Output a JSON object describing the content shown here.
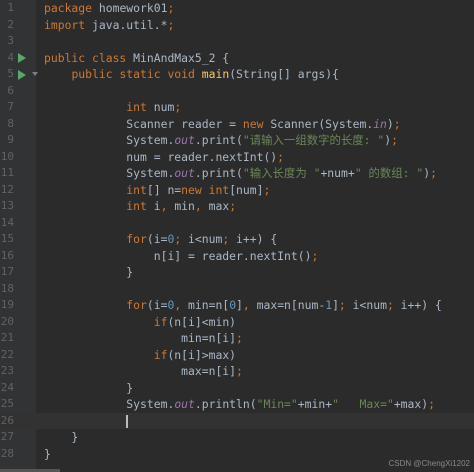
{
  "editor": {
    "lines": [
      {
        "n": "1",
        "tokens": [
          {
            "c": "kw",
            "t": "package "
          },
          {
            "c": "txt",
            "t": "homework01"
          },
          {
            "c": "kw",
            "t": ";"
          }
        ]
      },
      {
        "n": "2",
        "tokens": [
          {
            "c": "kw",
            "t": "import "
          },
          {
            "c": "txt",
            "t": "java.util.*"
          },
          {
            "c": "kw",
            "t": ";"
          }
        ]
      },
      {
        "n": "3",
        "tokens": []
      },
      {
        "n": "4",
        "gutter": "run-icon",
        "tokens": [
          {
            "c": "kw",
            "t": "public class "
          },
          {
            "c": "txt",
            "t": "MinAndMax5_2 {"
          }
        ]
      },
      {
        "n": "5",
        "gutter": "run-icon",
        "fold": true,
        "tokens": [
          {
            "c": "txt",
            "t": "    "
          },
          {
            "c": "kw",
            "t": "public static void "
          },
          {
            "c": "fn",
            "t": "main"
          },
          {
            "c": "txt",
            "t": "(String[] args){"
          }
        ]
      },
      {
        "n": "6",
        "tokens": []
      },
      {
        "n": "7",
        "tokens": [
          {
            "c": "txt",
            "t": "            "
          },
          {
            "c": "kw",
            "t": "int "
          },
          {
            "c": "txt",
            "t": "num"
          },
          {
            "c": "kw",
            "t": ";"
          }
        ]
      },
      {
        "n": "8",
        "tokens": [
          {
            "c": "txt",
            "t": "            Scanner reader = "
          },
          {
            "c": "kw",
            "t": "new "
          },
          {
            "c": "txt",
            "t": "Scanner(System."
          },
          {
            "c": "fld",
            "t": "in"
          },
          {
            "c": "txt",
            "t": ")"
          },
          {
            "c": "kw",
            "t": ";"
          }
        ]
      },
      {
        "n": "9",
        "tokens": [
          {
            "c": "txt",
            "t": "            System."
          },
          {
            "c": "fld",
            "t": "out"
          },
          {
            "c": "txt",
            "t": ".print("
          },
          {
            "c": "str",
            "t": "\"请输入一组数字的长度: \""
          },
          {
            "c": "txt",
            "t": ")"
          },
          {
            "c": "kw",
            "t": ";"
          }
        ]
      },
      {
        "n": "10",
        "tokens": [
          {
            "c": "txt",
            "t": "            num = reader.nextInt()"
          },
          {
            "c": "kw",
            "t": ";"
          }
        ]
      },
      {
        "n": "11",
        "tokens": [
          {
            "c": "txt",
            "t": "            System."
          },
          {
            "c": "fld",
            "t": "out"
          },
          {
            "c": "txt",
            "t": ".print("
          },
          {
            "c": "str",
            "t": "\"输入长度为 \""
          },
          {
            "c": "txt",
            "t": "+num+"
          },
          {
            "c": "str",
            "t": "\" 的数组: \""
          },
          {
            "c": "txt",
            "t": ")"
          },
          {
            "c": "kw",
            "t": ";"
          }
        ]
      },
      {
        "n": "12",
        "tokens": [
          {
            "c": "txt",
            "t": "            "
          },
          {
            "c": "kw",
            "t": "int"
          },
          {
            "c": "txt",
            "t": "[] n="
          },
          {
            "c": "kw",
            "t": "new int"
          },
          {
            "c": "txt",
            "t": "[num]"
          },
          {
            "c": "kw",
            "t": ";"
          }
        ]
      },
      {
        "n": "13",
        "tokens": [
          {
            "c": "txt",
            "t": "            "
          },
          {
            "c": "kw",
            "t": "int "
          },
          {
            "c": "txt",
            "t": "i"
          },
          {
            "c": "kw",
            "t": ", "
          },
          {
            "c": "txt",
            "t": "min"
          },
          {
            "c": "kw",
            "t": ", "
          },
          {
            "c": "txt",
            "t": "max"
          },
          {
            "c": "kw",
            "t": ";"
          }
        ]
      },
      {
        "n": "14",
        "tokens": []
      },
      {
        "n": "15",
        "tokens": [
          {
            "c": "txt",
            "t": "            "
          },
          {
            "c": "kw",
            "t": "for"
          },
          {
            "c": "txt",
            "t": "(i="
          },
          {
            "c": "num",
            "t": "0"
          },
          {
            "c": "kw",
            "t": "; "
          },
          {
            "c": "txt",
            "t": "i<num"
          },
          {
            "c": "kw",
            "t": "; "
          },
          {
            "c": "txt",
            "t": "i++) {"
          }
        ]
      },
      {
        "n": "16",
        "tokens": [
          {
            "c": "txt",
            "t": "                n[i] = reader.nextInt()"
          },
          {
            "c": "kw",
            "t": ";"
          }
        ]
      },
      {
        "n": "17",
        "tokens": [
          {
            "c": "txt",
            "t": "            }"
          }
        ]
      },
      {
        "n": "18",
        "tokens": []
      },
      {
        "n": "19",
        "tokens": [
          {
            "c": "txt",
            "t": "            "
          },
          {
            "c": "kw",
            "t": "for"
          },
          {
            "c": "txt",
            "t": "(i="
          },
          {
            "c": "num",
            "t": "0"
          },
          {
            "c": "kw",
            "t": ", "
          },
          {
            "c": "txt",
            "t": "min=n["
          },
          {
            "c": "num",
            "t": "0"
          },
          {
            "c": "txt",
            "t": "]"
          },
          {
            "c": "kw",
            "t": ", "
          },
          {
            "c": "txt",
            "t": "max=n[num-"
          },
          {
            "c": "num",
            "t": "1"
          },
          {
            "c": "txt",
            "t": "]"
          },
          {
            "c": "kw",
            "t": "; "
          },
          {
            "c": "txt",
            "t": "i<num"
          },
          {
            "c": "kw",
            "t": "; "
          },
          {
            "c": "txt",
            "t": "i++) {"
          }
        ]
      },
      {
        "n": "20",
        "tokens": [
          {
            "c": "txt",
            "t": "                "
          },
          {
            "c": "kw",
            "t": "if"
          },
          {
            "c": "txt",
            "t": "(n[i]<min)"
          }
        ]
      },
      {
        "n": "21",
        "tokens": [
          {
            "c": "txt",
            "t": "                    min=n[i]"
          },
          {
            "c": "kw",
            "t": ";"
          }
        ]
      },
      {
        "n": "22",
        "tokens": [
          {
            "c": "txt",
            "t": "                "
          },
          {
            "c": "kw",
            "t": "if"
          },
          {
            "c": "txt",
            "t": "(n[i]>max)"
          }
        ]
      },
      {
        "n": "23",
        "tokens": [
          {
            "c": "txt",
            "t": "                    max=n[i]"
          },
          {
            "c": "kw",
            "t": ";"
          }
        ]
      },
      {
        "n": "24",
        "tokens": [
          {
            "c": "txt",
            "t": "            }"
          }
        ]
      },
      {
        "n": "25",
        "tokens": [
          {
            "c": "txt",
            "t": "            System."
          },
          {
            "c": "fld",
            "t": "out"
          },
          {
            "c": "txt",
            "t": ".println("
          },
          {
            "c": "str",
            "t": "\"Min=\""
          },
          {
            "c": "txt",
            "t": "+min+"
          },
          {
            "c": "str",
            "t": "\"   Max=\""
          },
          {
            "c": "txt",
            "t": "+max)"
          },
          {
            "c": "kw",
            "t": ";"
          }
        ]
      },
      {
        "n": "26",
        "current": true,
        "caret_col": 12,
        "tokens": []
      },
      {
        "n": "27",
        "tokens": [
          {
            "c": "txt",
            "t": "    }"
          }
        ]
      },
      {
        "n": "28",
        "tokens": [
          {
            "c": "txt",
            "t": "}"
          }
        ]
      }
    ]
  },
  "watermark": "CSDN @ChengXi1202",
  "colors": {
    "background": "#2b2b2b",
    "gutter": "#313335",
    "keyword": "#cc7832",
    "string": "#6a8759",
    "number": "#6897bb",
    "field": "#9876aa",
    "method": "#ffc66d",
    "text": "#a9b7c6",
    "line_number": "#606366",
    "run_icon": "#59a869"
  }
}
